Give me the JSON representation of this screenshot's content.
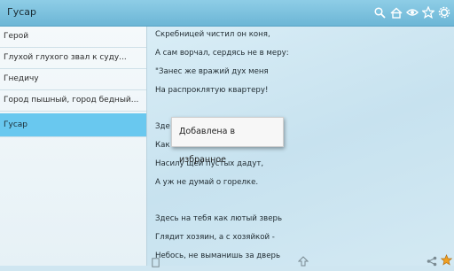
{
  "app": {
    "title": "Гусар"
  },
  "actionbar_icons": [
    "search-icon",
    "home-icon",
    "eye-icon",
    "star-icon",
    "gear-icon"
  ],
  "sidebar": {
    "items": [
      {
        "label": "Герой"
      },
      {
        "label": "Глухой глухого звал к суду..."
      },
      {
        "label": "Гнедичу"
      },
      {
        "label": "Город пышный, город бедный..."
      },
      {
        "label": "Гусар",
        "selected": true
      }
    ]
  },
  "poem": {
    "lines": [
      "Скребницей чистил он коня,",
      "А сам ворчал, сердясь не в меру:",
      "\"Занес же вражий дух меня",
      "На распроклятую квартеру!",
      "Зде",
      "Как",
      "Насилу щей пустых дадут,",
      "А уж не думай о горелке.",
      "Здесь на тебя как лютый зверь",
      "Глядит хозяин, а с хозяйкой -",
      "Небось, не выманишь за дверь"
    ]
  },
  "toast": {
    "text": "Добавлена в избранное"
  },
  "colors": {
    "accent": "#69c8ef",
    "actionbar": "#7cc1de",
    "star": "#f0a020"
  }
}
